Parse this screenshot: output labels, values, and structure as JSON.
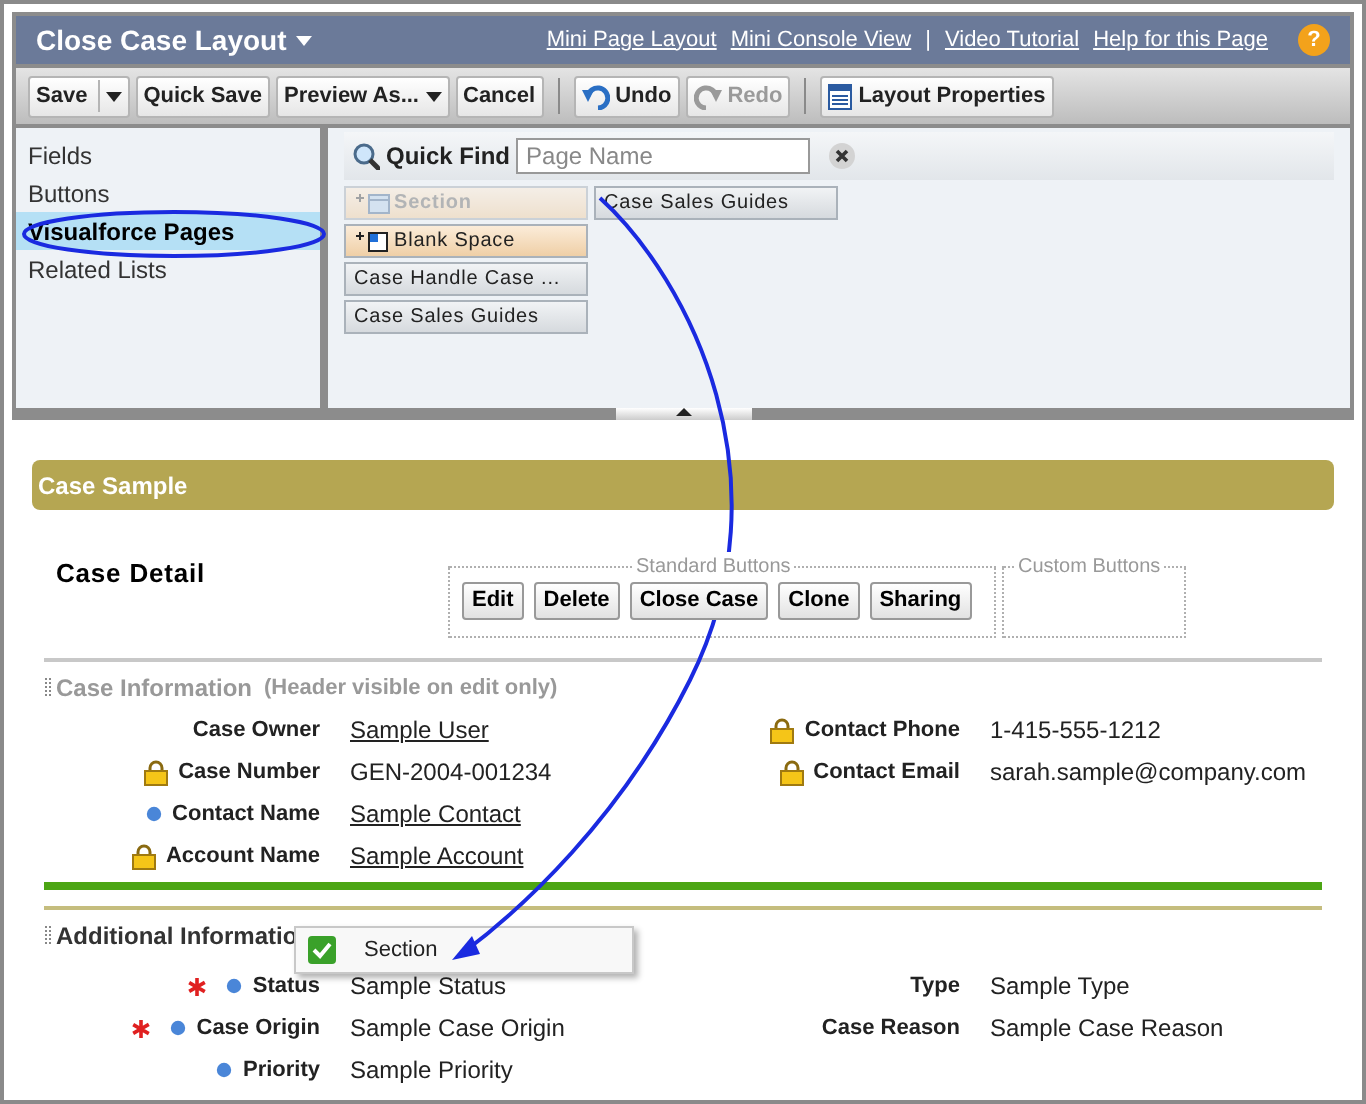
{
  "header": {
    "title": "Close Case Layout",
    "links": [
      {
        "kind": "link",
        "label": "Mini Page Layout"
      },
      {
        "kind": "link",
        "label": "Mini Console View"
      },
      {
        "kind": "separator",
        "label": "|"
      },
      {
        "kind": "link",
        "label": "Video Tutorial"
      },
      {
        "kind": "link",
        "label": "Help for this Page"
      }
    ],
    "help_icon": "?"
  },
  "toolbar": [
    {
      "label": "Save",
      "kind": "split",
      "disabled": false
    },
    {
      "label": "Quick Save",
      "kind": "plain",
      "disabled": false
    },
    {
      "label": "Preview As...",
      "kind": "dropdown",
      "disabled": false
    },
    {
      "label": "Cancel",
      "kind": "plain",
      "disabled": false
    },
    {
      "kind": "divider"
    },
    {
      "label": "Undo",
      "kind": "undo",
      "disabled": false
    },
    {
      "label": "Redo",
      "kind": "redo",
      "disabled": true
    },
    {
      "kind": "divider"
    },
    {
      "label": "Layout Properties",
      "kind": "properties",
      "disabled": false
    }
  ],
  "palette": {
    "categories": [
      {
        "label": "Fields",
        "selected": false
      },
      {
        "label": "Buttons",
        "selected": false
      },
      {
        "label": "Visualforce Pages",
        "selected": true
      },
      {
        "label": "Related Lists",
        "selected": false
      }
    ],
    "quick_find": {
      "label": "Quick Find",
      "placeholder": "Page Name"
    },
    "columns": [
      [
        {
          "label": "Section",
          "kind": "section",
          "disabled": true
        },
        {
          "label": "Blank Space",
          "kind": "blank",
          "disabled": false
        },
        {
          "label": "Case Handle Case ...",
          "kind": "page",
          "disabled": false
        },
        {
          "label": "Case Sales Guides",
          "kind": "page",
          "disabled": false
        }
      ],
      [
        {
          "label": "Case Sales Guides",
          "kind": "page",
          "disabled": false
        }
      ]
    ]
  },
  "layout": {
    "title": "Case Sample",
    "detail_title": "Case Detail",
    "standard_buttons": {
      "legend": "Standard Buttons",
      "buttons": [
        "Edit",
        "Delete",
        "Close Case",
        "Clone",
        "Sharing"
      ]
    },
    "custom_buttons": {
      "legend": "Custom Buttons"
    },
    "sections": [
      {
        "title": "Case Information",
        "note": "(Header visible on edit only)",
        "rows": [
          [
            {
              "label": "Case Owner",
              "value": "Sample User",
              "link": true,
              "kind": "plain"
            },
            {
              "label": "Contact Phone",
              "value": "1-415-555-1212",
              "link": false,
              "kind": "locked"
            }
          ],
          [
            {
              "label": "Case Number",
              "value": "GEN-2004-001234",
              "link": false,
              "kind": "locked"
            },
            {
              "label": "Contact Email",
              "value": "sarah.sample@company.com",
              "link": false,
              "kind": "locked"
            }
          ],
          [
            {
              "label": "Contact Name",
              "value": "Sample Contact",
              "link": true,
              "kind": "dotted"
            }
          ],
          [
            {
              "label": "Account Name",
              "value": "Sample Account",
              "link": true,
              "kind": "locked"
            }
          ]
        ]
      },
      {
        "title": "Additional Informatio",
        "rows": [
          [
            {
              "label": "Status",
              "value": "Sample Status",
              "link": false,
              "kind": "dotted",
              "required": true
            },
            {
              "label": "Type",
              "value": "Sample Type",
              "link": false,
              "kind": "plain"
            }
          ],
          [
            {
              "label": "Case Origin",
              "value": "Sample Case Origin",
              "link": false,
              "kind": "dotted",
              "required": true
            },
            {
              "label": "Case Reason",
              "value": "Sample Case Reason",
              "link": false,
              "kind": "plain"
            }
          ],
          [
            {
              "label": "Priority",
              "value": "Sample Priority",
              "link": false,
              "kind": "dotted"
            }
          ]
        ]
      }
    ]
  },
  "drag_tooltip": {
    "label": "Section"
  }
}
